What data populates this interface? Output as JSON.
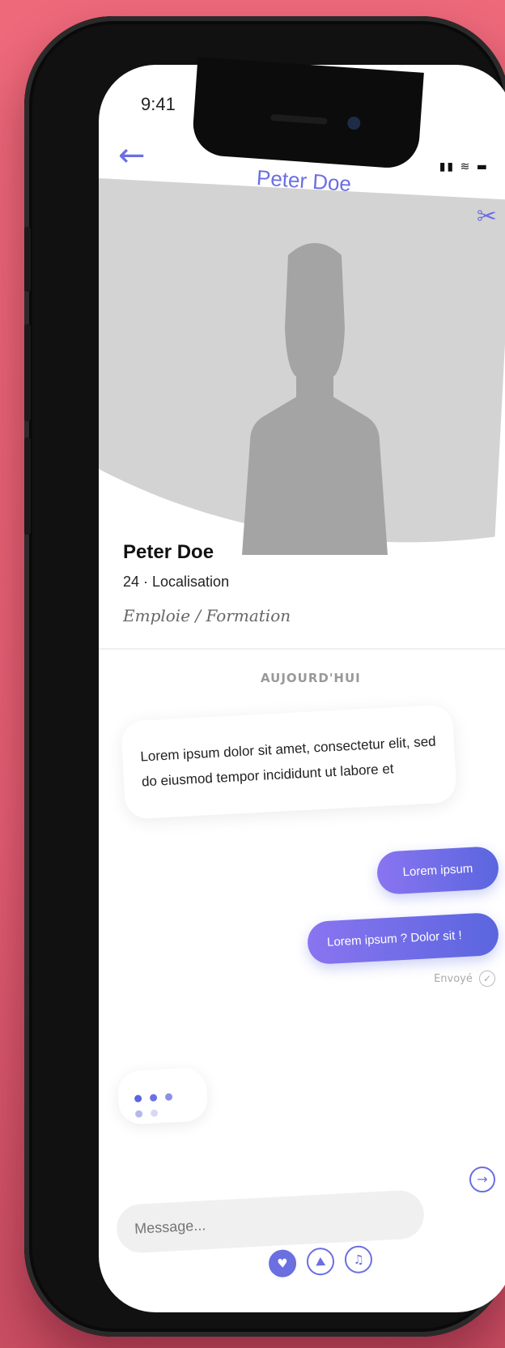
{
  "status": {
    "time": "9:41",
    "icons": "▮▮ ≋ ▬"
  },
  "header": {
    "title": "Peter Doe",
    "back_icon": "←",
    "tools_icon": "✂"
  },
  "profile": {
    "name": "Peter Doe",
    "meta": "24 · Localisation",
    "job": "Emploie / Formation"
  },
  "chat": {
    "day_label": "AUJOURD'HUI",
    "incoming": "Lorem ipsum dolor sit amet, consectetur elit, sed do eiusmod tempor incididunt ut labore et",
    "outgoing": [
      "Lorem ipsum",
      "Lorem ipsum ? Dolor sit !"
    ],
    "status": "Envoyé"
  },
  "composer": {
    "placeholder": "Message...",
    "send_icon": "→",
    "attachments": [
      "heart-icon",
      "image-icon",
      "music-icon"
    ]
  },
  "colors": {
    "accent": "#6b6fe0",
    "background": "#ee6a7b"
  }
}
